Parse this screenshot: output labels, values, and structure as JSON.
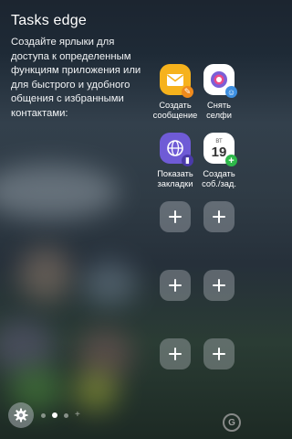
{
  "panel": {
    "title": "Tasks edge",
    "description": "Создайте ярлыки для доступа к определенным функциям приложения или для быстрого и удобного общения с избранными контактами:"
  },
  "shortcuts": [
    {
      "label": "Создать сообщение",
      "icon": "message-envelope-icon",
      "color": "#f6b21c"
    },
    {
      "label": "Снять селфи",
      "icon": "camera-selfie-icon",
      "color": "#ffffff"
    },
    {
      "label": "Показать закладки",
      "icon": "internet-globe-icon",
      "color": "#6f5bd6"
    },
    {
      "label": "Создать соб./зад.",
      "icon": "calendar-icon",
      "color": "#ffffff",
      "calendar_day": "ВТ",
      "calendar_date": "19"
    }
  ],
  "empty_slots_count": 6,
  "pagination": {
    "pages": 3,
    "active": 1
  },
  "watermark": "G"
}
